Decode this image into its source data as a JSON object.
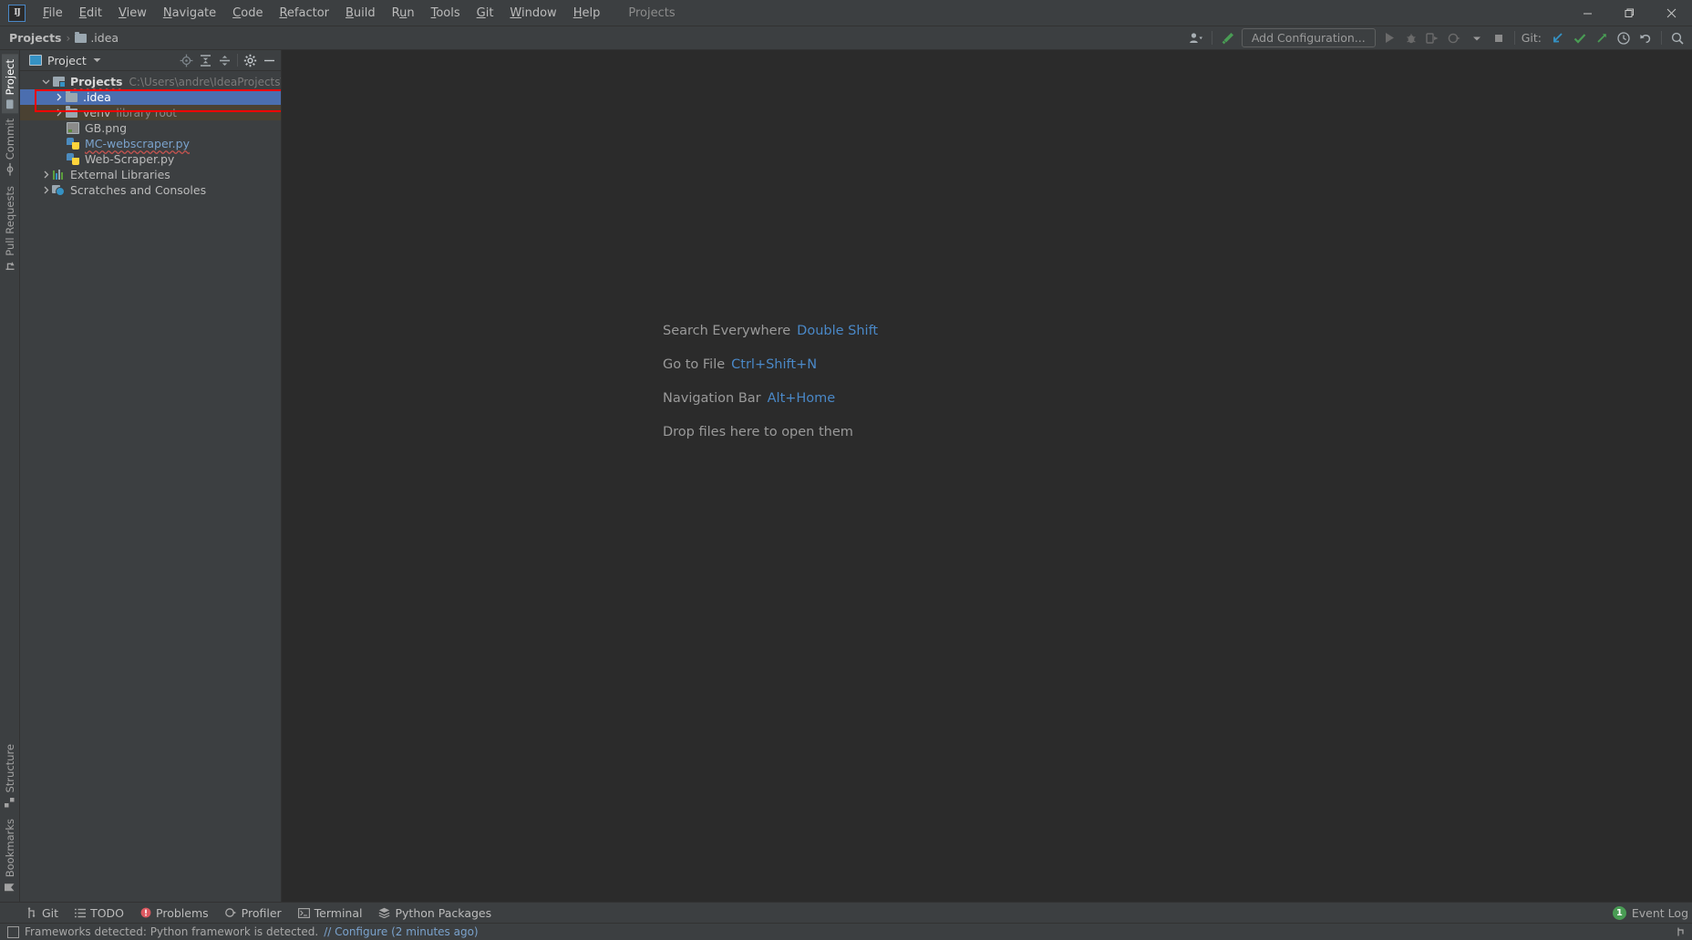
{
  "window": {
    "logo": "IJ",
    "project_label": "Projects",
    "controls": {
      "minimize": "—",
      "maximize": "❐",
      "close": "✕"
    }
  },
  "menubar": {
    "items": [
      {
        "label": "File",
        "mnemonic": "F"
      },
      {
        "label": "Edit",
        "mnemonic": "E"
      },
      {
        "label": "View",
        "mnemonic": "V"
      },
      {
        "label": "Navigate",
        "mnemonic": "N"
      },
      {
        "label": "Code",
        "mnemonic": "C"
      },
      {
        "label": "Refactor",
        "mnemonic": "R"
      },
      {
        "label": "Build",
        "mnemonic": "B"
      },
      {
        "label": "Run",
        "mnemonic": "u"
      },
      {
        "label": "Tools",
        "mnemonic": "T"
      },
      {
        "label": "Git",
        "mnemonic": "G"
      },
      {
        "label": "Window",
        "mnemonic": "W"
      },
      {
        "label": "Help",
        "mnemonic": "H"
      }
    ]
  },
  "navbar": {
    "breadcrumbs": [
      "Projects",
      ".idea"
    ],
    "separator": "›",
    "add_configuration": "Add Configuration...",
    "git_label": "Git:",
    "icons": [
      "user-avatar-icon",
      "hammer-icon",
      "run-icon",
      "debug-icon",
      "run-coverage-icon",
      "profile-icon",
      "stop-icon",
      "git-update-icon",
      "git-commit-icon",
      "git-push-icon",
      "history-icon",
      "undo-icon",
      "search-icon"
    ]
  },
  "left_strip": {
    "top_tabs": [
      {
        "label": "Project",
        "icon": "project-icon",
        "active": true
      },
      {
        "label": "Commit",
        "icon": "commit-icon",
        "active": false
      },
      {
        "label": "Pull Requests",
        "icon": "pull-request-icon",
        "active": false
      }
    ],
    "bottom_tabs": [
      {
        "label": "Structure",
        "icon": "structure-icon",
        "active": false
      },
      {
        "label": "Bookmarks",
        "icon": "bookmark-icon",
        "active": false
      }
    ]
  },
  "project_panel": {
    "title": "Project",
    "title_icon": "project-window-icon",
    "dropdown_caret": "▾",
    "actions": [
      "scroll-from-source-icon",
      "expand-all-icon",
      "collapse-all-icon",
      "settings-gear-icon",
      "hide-icon"
    ],
    "tree": [
      {
        "label": "Projects",
        "detail": "C:\\Users\\andre\\IdeaProjects\\Projects",
        "icon": "module-icon",
        "depth": 0,
        "arrow": "⌄",
        "expanded": true,
        "bold": true,
        "state": "normal"
      },
      {
        "label": ".idea",
        "detail": "",
        "icon": "folder-icon",
        "depth": 1,
        "arrow": "›",
        "expanded": false,
        "bold": false,
        "state": "selected"
      },
      {
        "label": "venv",
        "detail": "library root",
        "icon": "folder-icon",
        "depth": 1,
        "arrow": "›",
        "expanded": false,
        "bold": false,
        "state": "highlighted"
      },
      {
        "label": "GB.png",
        "detail": "",
        "icon": "image-file-icon",
        "depth": 2,
        "arrow": "",
        "expanded": false,
        "bold": false,
        "state": "normal"
      },
      {
        "label": "MC-webscraper.py",
        "detail": "",
        "icon": "python-file-icon",
        "depth": 2,
        "arrow": "",
        "expanded": false,
        "bold": false,
        "state": "link-error"
      },
      {
        "label": "Web-Scraper.py",
        "detail": "",
        "icon": "python-file-icon",
        "depth": 2,
        "arrow": "",
        "expanded": false,
        "bold": false,
        "state": "normal"
      },
      {
        "label": "External Libraries",
        "detail": "",
        "icon": "external-libraries-icon",
        "depth": 0,
        "arrow": "›",
        "expanded": false,
        "bold": false,
        "state": "normal"
      },
      {
        "label": "Scratches and Consoles",
        "detail": "",
        "icon": "scratches-icon",
        "depth": 0,
        "arrow": "›",
        "expanded": false,
        "bold": false,
        "state": "normal"
      }
    ],
    "highlight_color": "#ff0000"
  },
  "editor": {
    "hints": [
      {
        "text": "Search Everywhere",
        "key": "Double Shift"
      },
      {
        "text": "Go to File",
        "key": "Ctrl+Shift+N"
      },
      {
        "text": "Navigation Bar",
        "key": "Alt+Home"
      },
      {
        "text": "Drop files here to open them",
        "key": ""
      }
    ]
  },
  "bottom_toolwindows": {
    "items": [
      {
        "label": "Git",
        "icon": "git-branch-icon"
      },
      {
        "label": "TODO",
        "icon": "todo-list-icon"
      },
      {
        "label": "Problems",
        "icon": "problems-error-icon"
      },
      {
        "label": "Profiler",
        "icon": "profiler-icon"
      },
      {
        "label": "Terminal",
        "icon": "terminal-icon"
      },
      {
        "label": "Python Packages",
        "icon": "packages-icon"
      }
    ],
    "event_log": {
      "label": "Event Log",
      "count": "1"
    }
  },
  "status_bar": {
    "icon": "notification-icon",
    "message": "Frameworks detected: Python framework is detected.",
    "link": "// Configure (2 minutes ago)"
  },
  "colors": {
    "background": "#3c3f41",
    "editor_background": "#2b2b2b",
    "selection_blue": "#4b6eaf",
    "highlight_olive": "#4a4132",
    "link_blue": "#4a88c7",
    "accent_green": "#499c54",
    "error_red": "#c75450"
  }
}
